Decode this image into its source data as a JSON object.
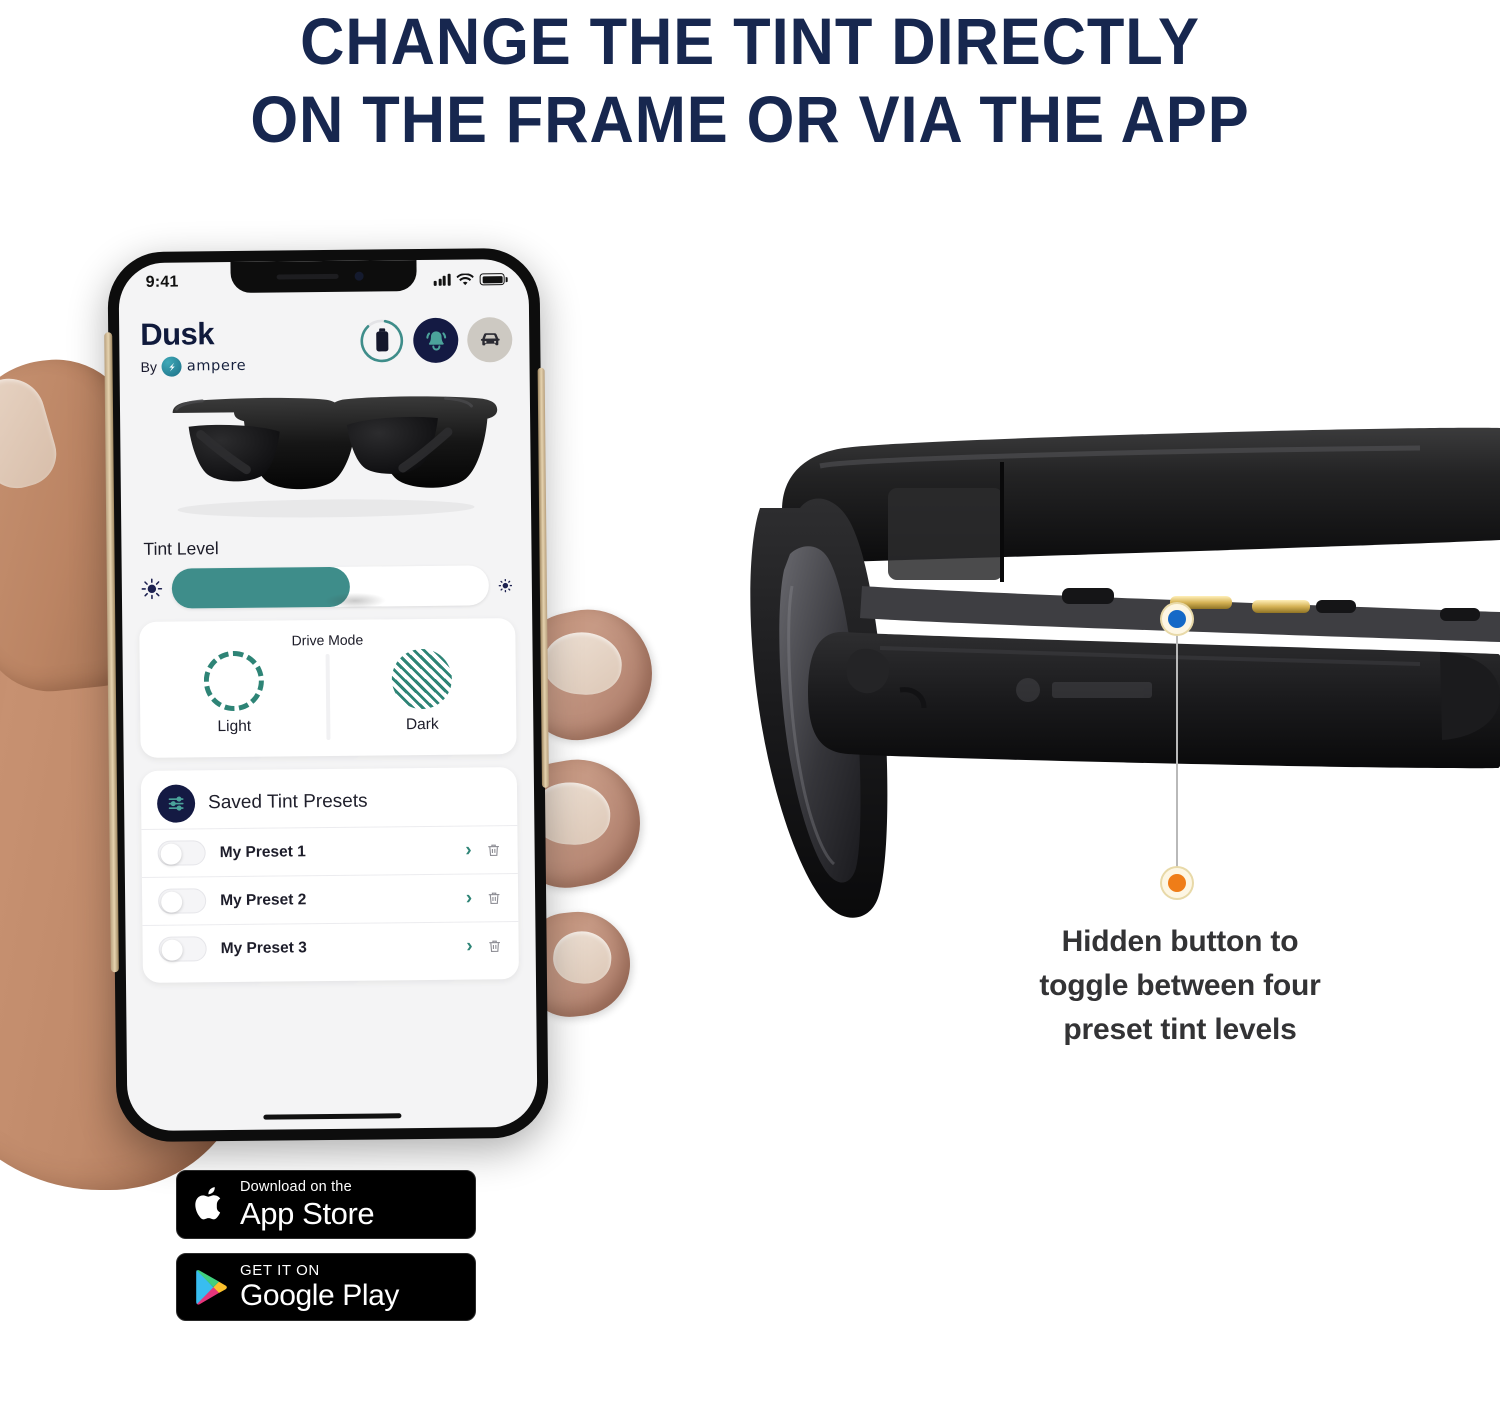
{
  "headline": {
    "line1": "CHANGE THE TINT DIRECTLY",
    "line2": "ON THE FRAME OR VIA THE APP",
    "color": "#17274f"
  },
  "phone": {
    "status_bar": {
      "time": "9:41",
      "signal_icon": "cellular-bars-icon",
      "wifi_icon": "wifi-icon",
      "battery_icon": "battery-icon"
    },
    "app": {
      "brand": {
        "title": "Dusk",
        "by_label": "By",
        "logo_icon": "ampere-logo-icon",
        "wordmark": "ampere"
      },
      "header_icons": [
        {
          "name": "battery-status-icon",
          "label": "Battery",
          "level_percent": 85,
          "ring_color": "#3e8d8a"
        },
        {
          "name": "bell-icon",
          "label": "Alerts",
          "bg_color": "#141a43",
          "glyph_color": "#4ba39b"
        },
        {
          "name": "car-icon",
          "label": "Drive",
          "bg_color": "#cdc9c2",
          "glyph_color": "#2b2b33"
        }
      ],
      "product_image": "sunglasses-front-image",
      "tint": {
        "label": "Tint Level",
        "value_percent": 56,
        "fill_color": "#3e8d8a",
        "low_icon": "sun-bright-icon",
        "high_icon": "sun-dim-icon"
      },
      "drive_mode": {
        "title": "Drive Mode",
        "options": [
          {
            "label": "Light",
            "icon": "dashed-circle-icon"
          },
          {
            "label": "Dark",
            "icon": "hatched-circle-icon"
          }
        ]
      },
      "presets": {
        "badge_icon": "sliders-icon",
        "title": "Saved Tint Presets",
        "items": [
          {
            "name": "My Preset 1",
            "enabled": false,
            "chevron_icon": "chevron-right-icon",
            "delete_icon": "trash-icon"
          },
          {
            "name": "My Preset 2",
            "enabled": false,
            "chevron_icon": "chevron-right-icon",
            "delete_icon": "trash-icon"
          },
          {
            "name": "My Preset 3",
            "enabled": false,
            "chevron_icon": "chevron-right-icon",
            "delete_icon": "trash-icon"
          }
        ]
      }
    }
  },
  "store_badges": [
    {
      "name": "app-store-badge",
      "icon": "apple-logo-icon",
      "small": "Download on the",
      "big": "App Store"
    },
    {
      "name": "google-play-badge",
      "icon": "google-play-logo-icon",
      "small": "GET IT ON",
      "big": "Google Play"
    }
  ],
  "callout": {
    "text_line1": "Hidden button to",
    "text_line2": "toggle between four",
    "text_line3": "preset tint levels",
    "marker_top_color": "#1569c7",
    "marker_bottom_color": "#ef7d18",
    "text_color": "#333335"
  },
  "product": {
    "name": "dusk-smart-sunglasses-side-view",
    "frame_color": "#191919"
  }
}
